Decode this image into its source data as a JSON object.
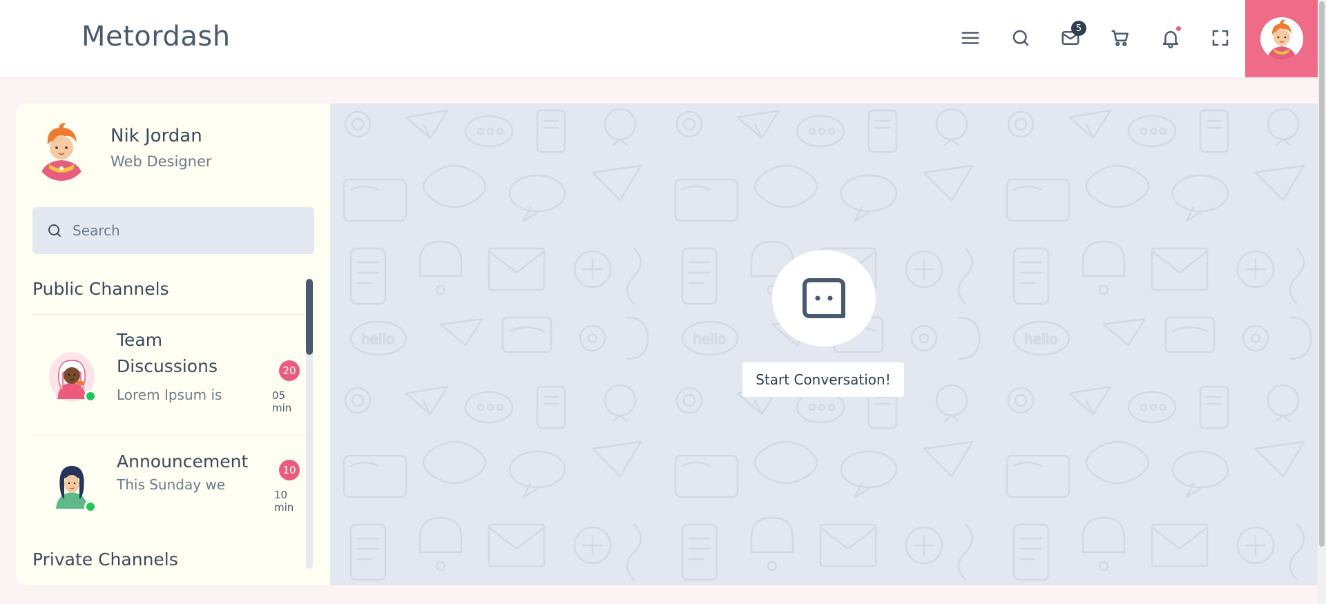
{
  "app": {
    "title": "Metordash"
  },
  "header": {
    "icons": [
      "menu-icon",
      "search-icon",
      "mail-icon",
      "cart-icon",
      "bell-icon",
      "fullscreen-icon"
    ],
    "mail_badge": "5",
    "accent_color": "#f06b88"
  },
  "user": {
    "name": "Nik Jordan",
    "role": "Web Designer"
  },
  "search": {
    "placeholder": "Search",
    "value": ""
  },
  "sections": {
    "public_title": "Public Channels",
    "private_title": "Private Channels"
  },
  "channels": [
    {
      "name_line1": "Team",
      "name_line2": "Discussions",
      "preview": "Lorem Ipsum is",
      "badge": "20",
      "time": "05 min",
      "online": true
    },
    {
      "name_line1": "Announcement",
      "name_line2": "",
      "preview": "This Sunday we",
      "badge": "10",
      "time": "10 min",
      "online": true
    }
  ],
  "chat": {
    "start_label": "Start Conversation!"
  },
  "colors": {
    "badge": "#ec5b7e",
    "online": "#22c55e",
    "chat_bg": "#e3e7ef",
    "sidebar_bg": "#fffef2"
  }
}
